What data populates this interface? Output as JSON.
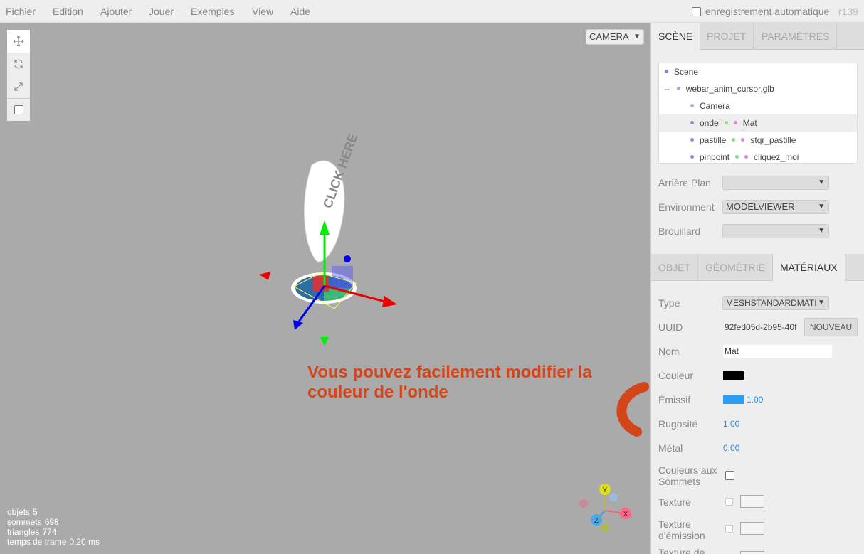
{
  "menubar": {
    "items": [
      "Fichier",
      "Edition",
      "Ajouter",
      "Jouer",
      "Exemples",
      "View",
      "Aide"
    ],
    "autosave_label": "enregistrement automatique",
    "version": "r139"
  },
  "viewport": {
    "camera_select": "CAMERA",
    "tools": [
      "translate-icon",
      "rotate-icon",
      "scale-icon",
      "local-checkbox"
    ],
    "info": {
      "objects_label": "objets",
      "objects": "5",
      "vertices_label": "sommets",
      "vertices": "698",
      "triangles_label": "triangles",
      "triangles": "774",
      "frametime_label": "temps de trame",
      "frametime": "0.20 ms"
    },
    "annotation": "Vous pouvez facilement modifier la couleur de l'onde",
    "annotation_color": "#d4451a",
    "sign_text": "CLICK HERE",
    "gizmo_labels": {
      "x": "X",
      "y": "Y",
      "z": "Z"
    }
  },
  "sidebar": {
    "tabs": [
      "SCÈNE",
      "PROJET",
      "PARAMÈTRES"
    ],
    "outliner": {
      "scene": "Scene",
      "collapse": "–",
      "file": "webar_anim_cursor.glb",
      "camera": "Camera",
      "onde": "onde",
      "onde_mat": "Mat",
      "pastille": "pastille",
      "pastille_mat": "stqr_pastille",
      "pinpoint": "pinpoint",
      "pinpoint_mat": "cliquez_moi"
    },
    "background_label": "Arrière Plan",
    "background_value": "",
    "environment_label": "Environment",
    "environment_value": "MODELVIEWER",
    "fog_label": "Brouillard",
    "fog_value": "",
    "prop_tabs": [
      "OBJET",
      "GÉOMÉTRIE",
      "MATÉRIAUX"
    ],
    "material": {
      "type_label": "Type",
      "type_value": "MESHSTANDARDMATI",
      "uuid_label": "UUID",
      "uuid_value": "92fed05d-2b95-40f",
      "uuid_button": "NOUVEAU",
      "name_label": "Nom",
      "name_value": "Mat",
      "color_label": "Couleur",
      "color_value": "#000000",
      "emissive_label": "Émissif",
      "emissive_color": "#2a9df4",
      "emissive_value": "1.00",
      "roughness_label": "Rugosité",
      "roughness_value": "1.00",
      "metal_label": "Métal",
      "metal_value": "0.00",
      "vertex_colors_label_1": "Couleurs aux",
      "vertex_colors_label_2": "Sommets",
      "texture_label": "Texture",
      "emissive_texture_label_1": "Texture",
      "emissive_texture_label_2": "d'émission",
      "next_texture_label": "Texture de"
    }
  }
}
